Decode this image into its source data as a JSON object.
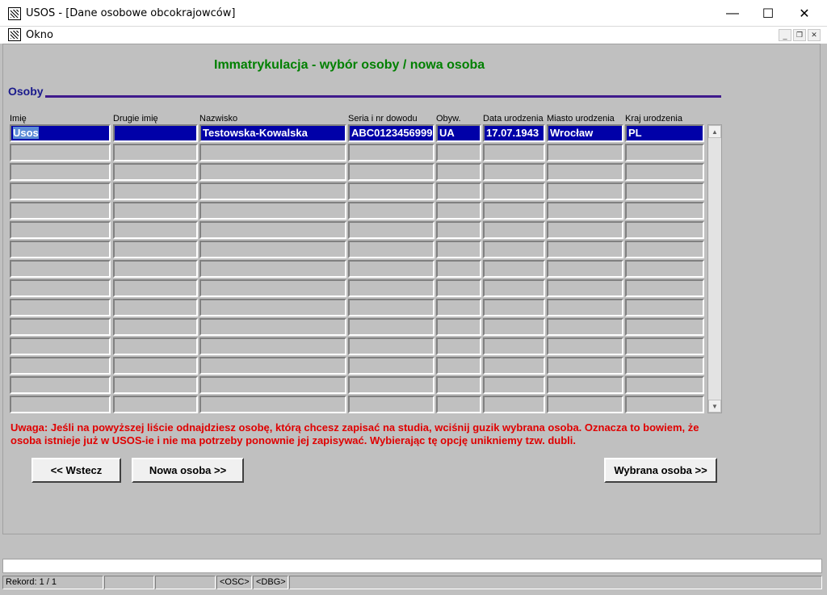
{
  "window": {
    "title": "USOS - [Dane osobowe obcokrajowców]",
    "menu_label": "Okno",
    "minimize": "—",
    "maximize": "☐",
    "close": "✕"
  },
  "form": {
    "title": "Immatrykulacja - wybór osoby / nowa osoba",
    "section": "Osoby"
  },
  "table": {
    "columns": [
      "Imię",
      "Drugie imię",
      "Nazwisko",
      "Seria i nr dowodu",
      "Obyw.",
      "Data urodzenia",
      "Miasto urodzenia",
      "Kraj urodzenia"
    ],
    "rows": [
      [
        "Usos",
        "",
        "Testowska-Kowalska",
        "ABC0123456999",
        "UA",
        "17.07.1943",
        "Wrocław",
        "PL"
      ]
    ],
    "total_rows": 15
  },
  "warning": "Uwaga: Jeśli na powyższej liście odnajdziesz osobę, którą chcesz zapisać na studia, wciśnij guzik wybrana osoba. Oznacza to bowiem, że osoba istnieje już w USOS-ie i nie ma potrzeby ponownie jej zapisywać. Wybierając tę opcję unikniemy tzw. dubli.",
  "buttons": {
    "back": "<< Wstecz",
    "new_person": "Nowa osoba >>",
    "selected_person": "Wybrana osoba >>"
  },
  "status": {
    "record": "Rekord: 1 / 1",
    "osc": "<OSC>",
    "dbg": "<DBG>"
  }
}
